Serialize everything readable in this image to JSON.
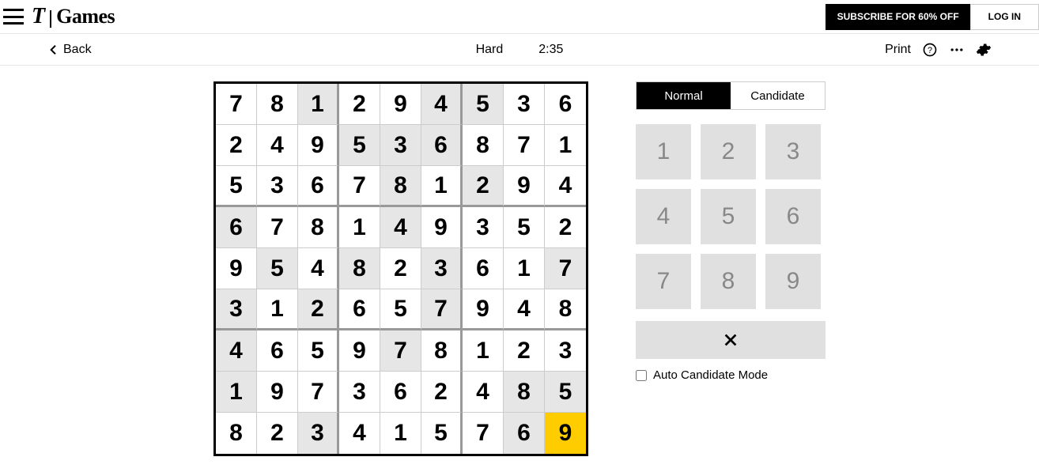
{
  "header": {
    "logo_left": "T",
    "logo_right": "Games",
    "subscribe_label": "SUBSCRIBE FOR 60% OFF",
    "login_label": "LOG IN"
  },
  "subbar": {
    "back_label": "Back",
    "difficulty": "Hard",
    "timer": "2:35",
    "print_label": "Print"
  },
  "panel": {
    "mode_normal": "Normal",
    "mode_candidate": "Candidate",
    "active_mode": "normal",
    "keys": [
      "1",
      "2",
      "3",
      "4",
      "5",
      "6",
      "7",
      "8",
      "9"
    ],
    "autocand_label": "Auto Candidate Mode",
    "autocand_checked": false
  },
  "board": {
    "selected": [
      8,
      8
    ],
    "cells": [
      [
        {
          "v": "7",
          "g": false
        },
        {
          "v": "8",
          "g": false
        },
        {
          "v": "1",
          "g": true
        },
        {
          "v": "2",
          "g": false
        },
        {
          "v": "9",
          "g": false
        },
        {
          "v": "4",
          "g": true
        },
        {
          "v": "5",
          "g": true
        },
        {
          "v": "3",
          "g": false
        },
        {
          "v": "6",
          "g": false
        }
      ],
      [
        {
          "v": "2",
          "g": false
        },
        {
          "v": "4",
          "g": false
        },
        {
          "v": "9",
          "g": false
        },
        {
          "v": "5",
          "g": true
        },
        {
          "v": "3",
          "g": true
        },
        {
          "v": "6",
          "g": true
        },
        {
          "v": "8",
          "g": false
        },
        {
          "v": "7",
          "g": false
        },
        {
          "v": "1",
          "g": false
        }
      ],
      [
        {
          "v": "5",
          "g": false
        },
        {
          "v": "3",
          "g": false
        },
        {
          "v": "6",
          "g": false
        },
        {
          "v": "7",
          "g": false
        },
        {
          "v": "8",
          "g": true
        },
        {
          "v": "1",
          "g": false
        },
        {
          "v": "2",
          "g": true
        },
        {
          "v": "9",
          "g": false
        },
        {
          "v": "4",
          "g": false
        }
      ],
      [
        {
          "v": "6",
          "g": true
        },
        {
          "v": "7",
          "g": false
        },
        {
          "v": "8",
          "g": false
        },
        {
          "v": "1",
          "g": false
        },
        {
          "v": "4",
          "g": true
        },
        {
          "v": "9",
          "g": false
        },
        {
          "v": "3",
          "g": false
        },
        {
          "v": "5",
          "g": false
        },
        {
          "v": "2",
          "g": false
        }
      ],
      [
        {
          "v": "9",
          "g": false
        },
        {
          "v": "5",
          "g": true
        },
        {
          "v": "4",
          "g": false
        },
        {
          "v": "8",
          "g": true
        },
        {
          "v": "2",
          "g": false
        },
        {
          "v": "3",
          "g": true
        },
        {
          "v": "6",
          "g": false
        },
        {
          "v": "1",
          "g": false
        },
        {
          "v": "7",
          "g": true
        }
      ],
      [
        {
          "v": "3",
          "g": true
        },
        {
          "v": "1",
          "g": false
        },
        {
          "v": "2",
          "g": true
        },
        {
          "v": "6",
          "g": false
        },
        {
          "v": "5",
          "g": false
        },
        {
          "v": "7",
          "g": true
        },
        {
          "v": "9",
          "g": false
        },
        {
          "v": "4",
          "g": false
        },
        {
          "v": "8",
          "g": false
        }
      ],
      [
        {
          "v": "4",
          "g": true
        },
        {
          "v": "6",
          "g": false
        },
        {
          "v": "5",
          "g": false
        },
        {
          "v": "9",
          "g": false
        },
        {
          "v": "7",
          "g": true
        },
        {
          "v": "8",
          "g": false
        },
        {
          "v": "1",
          "g": false
        },
        {
          "v": "2",
          "g": false
        },
        {
          "v": "3",
          "g": false
        }
      ],
      [
        {
          "v": "1",
          "g": true
        },
        {
          "v": "9",
          "g": false
        },
        {
          "v": "7",
          "g": false
        },
        {
          "v": "3",
          "g": false
        },
        {
          "v": "6",
          "g": false
        },
        {
          "v": "2",
          "g": false
        },
        {
          "v": "4",
          "g": false
        },
        {
          "v": "8",
          "g": true
        },
        {
          "v": "5",
          "g": true
        }
      ],
      [
        {
          "v": "8",
          "g": false
        },
        {
          "v": "2",
          "g": false
        },
        {
          "v": "3",
          "g": true
        },
        {
          "v": "4",
          "g": false
        },
        {
          "v": "1",
          "g": false
        },
        {
          "v": "5",
          "g": false
        },
        {
          "v": "7",
          "g": false
        },
        {
          "v": "6",
          "g": true
        },
        {
          "v": "9",
          "g": false
        }
      ]
    ]
  }
}
